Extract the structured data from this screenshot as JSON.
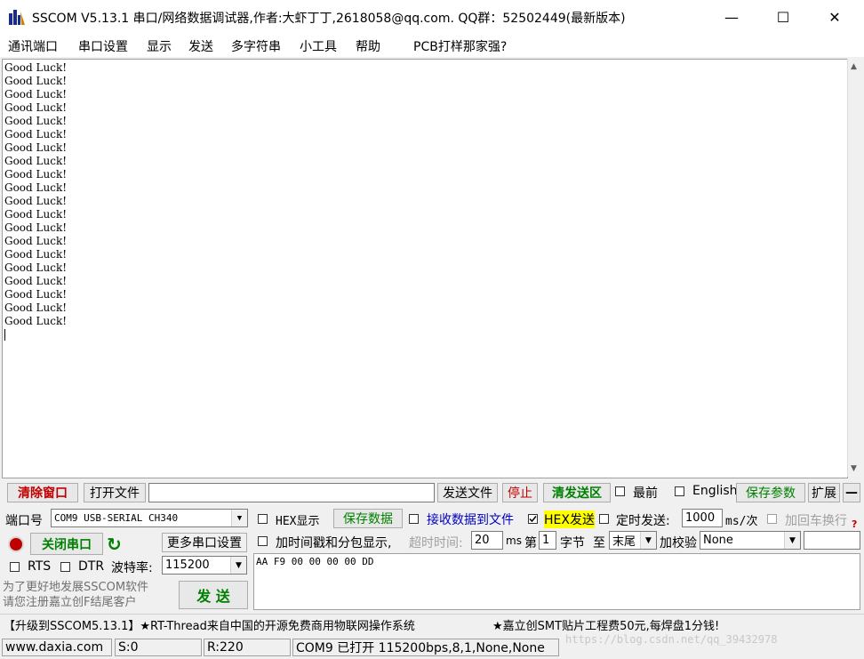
{
  "window": {
    "title": "SSCOM V5.13.1 串口/网络数据调试器,作者:大虾丁丁,2618058@qq.com. QQ群：52502449(最新版本)",
    "minimize": "—",
    "maximize": "☐",
    "close": "✕"
  },
  "menu": [
    "通讯端口",
    "串口设置",
    "显示",
    "发送",
    "多字符串",
    "小工具",
    "帮助",
    "PCB打样那家强?"
  ],
  "receive": {
    "lines": [
      "Good Luck!",
      "Good Luck!",
      "Good Luck!",
      "Good Luck!",
      "Good Luck!",
      "Good Luck!",
      "Good Luck!",
      "Good Luck!",
      "Good Luck!",
      "Good Luck!",
      "Good Luck!",
      "Good Luck!",
      "Good Luck!",
      "Good Luck!",
      "Good Luck!",
      "Good Luck!",
      "Good Luck!",
      "Good Luck!",
      "Good Luck!",
      "Good Luck!"
    ]
  },
  "toolbar": {
    "clear_window": "清除窗口",
    "open_file": "打开文件",
    "file_path": "",
    "send_file": "发送文件",
    "stop": "停止",
    "clear_send": "清发送区",
    "topmost": "最前",
    "english": "English",
    "save_params": "保存参数",
    "expand": "扩展",
    "collapse": "—"
  },
  "port": {
    "label": "端口号",
    "value": "COM9 USB-SERIAL CH340",
    "close_port": "关闭串口",
    "more_settings": "更多串口设置",
    "rts": "RTS",
    "dtr": "DTR",
    "baud_label": "波特率:",
    "baud_value": "115200"
  },
  "options": {
    "hex_display": "HEX显示",
    "save_data": "保存数据",
    "recv_to_file": "接收数据到文件",
    "hex_send": "HEX发送",
    "timed_send": "定时发送:",
    "interval": "1000",
    "interval_unit": "ms/次",
    "append_newline": "加回车换行",
    "timestamp": "加时间戳和分包显示,",
    "timeout_label": "超时时间:",
    "timeout_value": "20",
    "timeout_unit": "ms",
    "nth_label": "第",
    "nth_value": "1",
    "byte_label": "字节",
    "to_label": "至",
    "end_value": "末尾",
    "checksum_label": "加校验",
    "checksum_value": "None"
  },
  "send": {
    "text": "AA F9 00 00 00 00 DD",
    "button": "发 送",
    "promo_line1": "为了更好地发展SSCOM软件",
    "promo_line2": "请您注册嘉立创F结尾客户"
  },
  "ads": {
    "left": "【升级到SSCOM5.13.1】★RT-Thread来自中国的开源免费商用物联网操作系统",
    "right": "★嘉立创SMT贴片工程费50元,每焊盘1分钱!"
  },
  "status": {
    "site": "www.daxia.com",
    "sent": "S:0",
    "received": "R:220",
    "port_state": "COM9 已打开  115200bps,8,1,None,None",
    "watermark": "https://blog.csdn.net/qq_39432978"
  },
  "colors": {
    "red_text": "#c00000",
    "green_text": "#008000",
    "hex_send_highlight": "#ffff00"
  }
}
